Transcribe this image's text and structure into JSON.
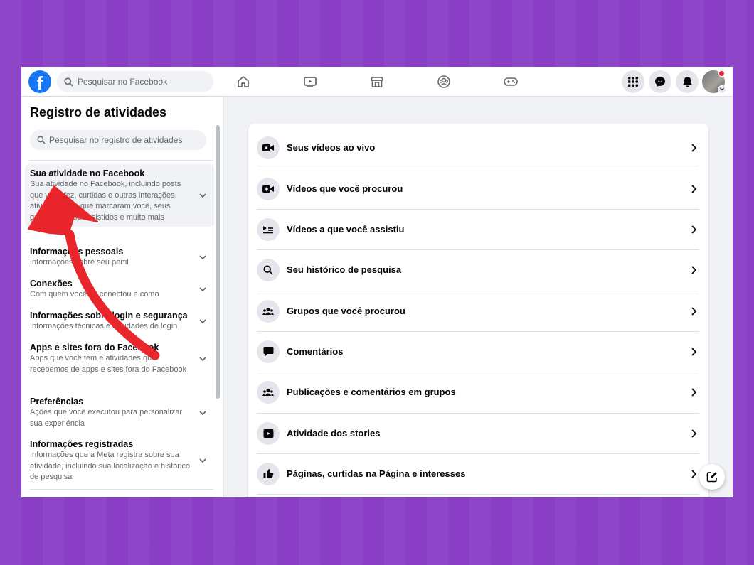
{
  "topbar": {
    "logo": "f",
    "search_placeholder": "Pesquisar no Facebook",
    "nav_icons": [
      "home-icon",
      "watch-icon",
      "marketplace-icon",
      "groups-icon",
      "gaming-icon"
    ],
    "right_icons": [
      "menu-grid-icon",
      "messenger-icon",
      "notifications-icon"
    ]
  },
  "sidebar": {
    "title": "Registro de atividades",
    "search_placeholder": "Pesquisar no registro de atividades",
    "items": [
      {
        "title": "Sua atividade no Facebook",
        "desc": "Sua atividade no Facebook, incluindo posts que você fez, curtidas e outras interações, atividades em que marcaram você, seus grupos, vídeos assistidos e muito mais"
      },
      {
        "title": "Informações pessoais",
        "desc": "Informações sobre seu perfil"
      },
      {
        "title": "Conexões",
        "desc": "Com quem você se conectou e como"
      },
      {
        "title": "Informações sobre login e segurança",
        "desc": "Informações técnicas e atividades de login"
      },
      {
        "title": "Apps e sites fora do Facebook",
        "desc": "Apps que você tem e atividades que recebemos de apps e sites fora do Facebook"
      },
      {
        "title": "Preferências",
        "desc": "Ações que você executou para personalizar sua experiência"
      },
      {
        "title": "Informações registradas",
        "desc": "Informações que a Meta registra sobre sua atividade, incluindo sua localização e histórico de pesquisa"
      }
    ]
  },
  "main": {
    "rows": [
      {
        "label": "Seus vídeos ao vivo",
        "icon": "live-video-icon"
      },
      {
        "label": "Vídeos que você procurou",
        "icon": "video-search-icon"
      },
      {
        "label": "Vídeos a que você assistiu",
        "icon": "watched-video-icon"
      },
      {
        "label": "Seu histórico de pesquisa",
        "icon": "search-icon"
      },
      {
        "label": "Grupos que você procurou",
        "icon": "groups-icon"
      },
      {
        "label": "Comentários",
        "icon": "comment-icon"
      },
      {
        "label": "Publicações e comentários em grupos",
        "icon": "groups-icon"
      },
      {
        "label": "Atividade dos stories",
        "icon": "stories-icon"
      },
      {
        "label": "Páginas, curtidas na Página e interesses",
        "icon": "thumbs-up-icon"
      }
    ]
  },
  "colors": {
    "accent": "#1877f2",
    "background": "#8a3ec6",
    "annotation_arrow": "#e8262b"
  }
}
